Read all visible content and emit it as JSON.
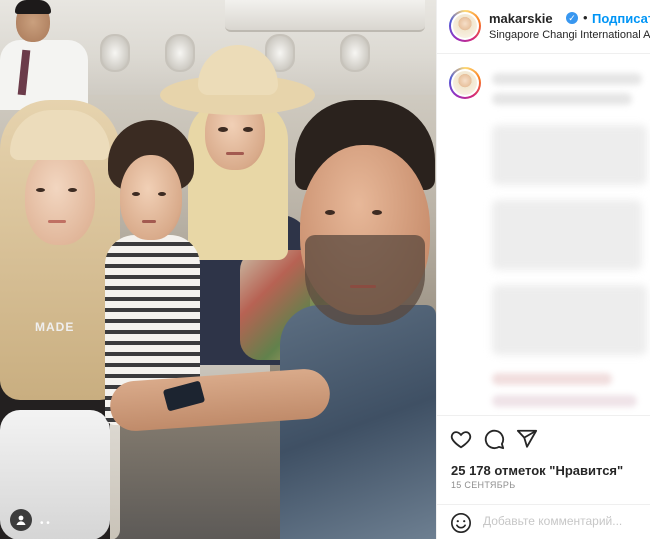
{
  "post": {
    "username": "makarskie",
    "follow_label": "Подписаться",
    "separator": "•",
    "location": "Singapore Changi International Airpo",
    "likes_text": "25 178 отметок \"Нравится\"",
    "date_text": "15 СЕНТЯБРЬ",
    "comment_placeholder": "Добавьте комментарий...",
    "photo_text": "MADE",
    "photo_dots": "• •"
  },
  "colors": {
    "accent": "#0095f6",
    "verified": "#3897f0",
    "muted": "#8e8e8e"
  },
  "icons": [
    "verified-badge-icon",
    "heart-icon",
    "comment-icon",
    "share-icon",
    "emoji-icon",
    "user-tag-icon"
  ]
}
